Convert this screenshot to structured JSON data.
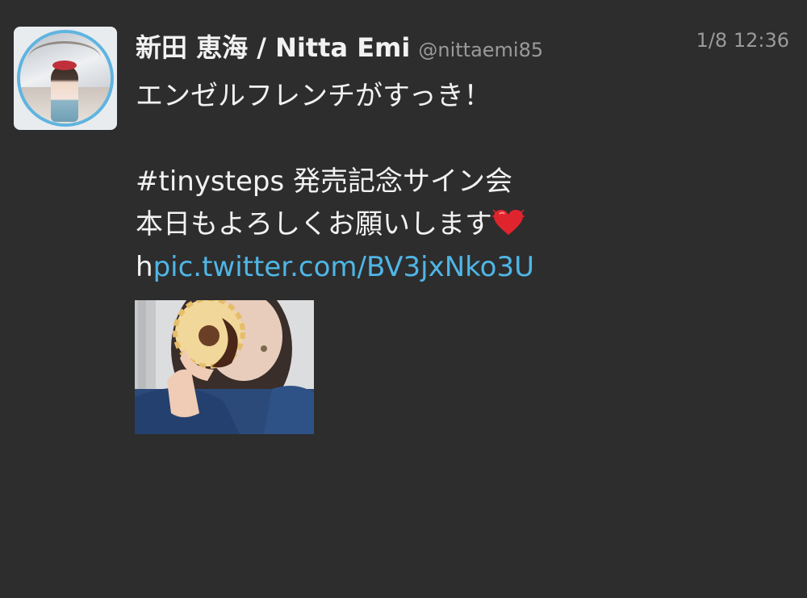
{
  "tweet": {
    "display_name": "新田 恵海 / Nitta Emi",
    "handle": "@nittaemi85",
    "timestamp": "1/8 12:36",
    "lines": [
      "エンゼルフレンチがすっき！",
      "",
      "#tinysteps 発売記念サイン会",
      "本日もよろしくお願いします"
    ],
    "link_prefix": "h",
    "link_text": "pic.twitter.com/BV3jxNko3U",
    "heart_icon": "red-heart-icon",
    "accent_color": "#4fb6e6"
  }
}
